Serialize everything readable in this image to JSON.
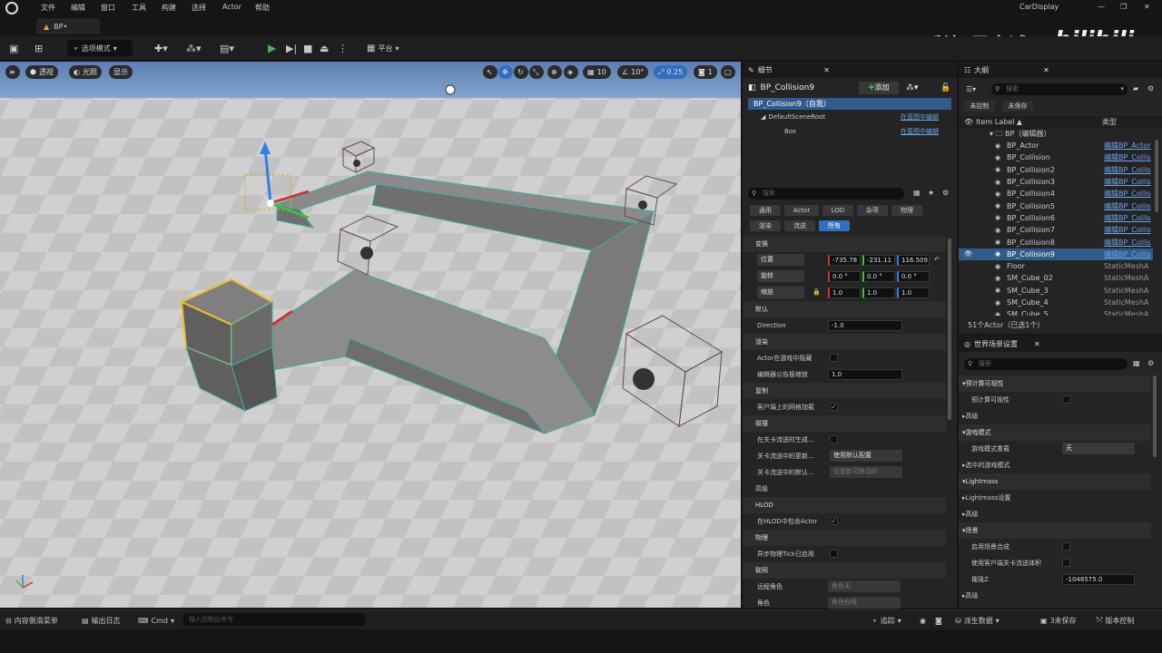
{
  "menu": {
    "items": [
      "文件",
      "编辑",
      "窗口",
      "工具",
      "构建",
      "选择",
      "Actor",
      "帮助"
    ],
    "window_title": "CarDisplay"
  },
  "tab": {
    "name": "BP•"
  },
  "watermark": {
    "author": "乔治-周士诚",
    "site": "bilibili"
  },
  "toolbar": {
    "mode": "选项模式",
    "platform": "平台"
  },
  "viewport": {
    "perspective": "透视",
    "lit": "光照",
    "show": "显示",
    "grid_snap": "10",
    "rot_snap": "10°",
    "scale_snap": "0.25",
    "cam_speed": "1"
  },
  "details": {
    "title": "细节",
    "actor": "BP_Collision9",
    "add": "添加",
    "tree": {
      "self": "BP_Collision9（自我）",
      "root": "DefaultSceneRoot",
      "box": "Box",
      "edit_bp": "在蓝图中编辑"
    },
    "search_placeholder": "搜索",
    "filters": [
      "通用",
      "Actor",
      "LOD",
      "杂项",
      "物理",
      "渲染",
      "流送",
      "所有"
    ],
    "transform": {
      "section": "变换",
      "location": "位置",
      "rotation": "旋转",
      "scale": "缩放",
      "loc": [
        "-735.78",
        "-231.11",
        "116.509"
      ],
      "rot": [
        "0.0 °",
        "0.0 °",
        "0.0 °"
      ],
      "scl": [
        "1.0",
        "1.0",
        "1.0"
      ]
    },
    "default": {
      "section": "默认",
      "direction_label": "Direction",
      "direction": "-1.0"
    },
    "rendering": {
      "section": "渲染",
      "hidden_label": "Actor在游戏中隐藏",
      "billboard_label": "编辑器公告板缩放",
      "billboard": "1.0"
    },
    "replication": {
      "section": "复制",
      "net_load_label": "客户端上的网格加载"
    },
    "collision": {
      "section": "碰撞",
      "gen_label": "在关卡流送时生成...",
      "update_label": "关卡流送中的更新...",
      "update_value": "使用默认配置",
      "default_label": "关卡流送中的默认...",
      "default_value": "仅更新可移动的"
    },
    "advanced": "高级",
    "hlod": {
      "section": "HLOD",
      "include_label": "在HLOD中包含Actor"
    },
    "physics": {
      "section": "物理",
      "async_label": "异步物理Tick已启用"
    },
    "networking": {
      "section": "联网",
      "remote_label": "远程角色",
      "remote_value": "角色无",
      "role_label": "角色",
      "role_value": "角色权限"
    }
  },
  "outliner": {
    "title": "大纲",
    "search_placeholder": "搜索",
    "unsaved_ctrl": "未控制",
    "unsaved": "未保存",
    "col_label": "Item Label ▲",
    "col_type": "类型",
    "folder": "BP（编辑器）",
    "items": [
      {
        "name": "BP_Actor",
        "type": "编辑BP_Actor"
      },
      {
        "name": "BP_Collision",
        "type": "编辑BP_Collis"
      },
      {
        "name": "BP_Collision2",
        "type": "编辑BP_Collis"
      },
      {
        "name": "BP_Collision3",
        "type": "编辑BP_Collis"
      },
      {
        "name": "BP_Collision4",
        "type": "编辑BP_Collis"
      },
      {
        "name": "BP_Collision5",
        "type": "编辑BP_Collis"
      },
      {
        "name": "BP_Collision6",
        "type": "编辑BP_Collis"
      },
      {
        "name": "BP_Collision7",
        "type": "编辑BP_Collis"
      },
      {
        "name": "BP_Collision8",
        "type": "编辑BP_Collis"
      },
      {
        "name": "BP_Collision9",
        "type": "编辑BP_Collis"
      },
      {
        "name": "Floor",
        "type": "StaticMeshA"
      },
      {
        "name": "SM_Cube_02",
        "type": "StaticMeshA"
      },
      {
        "name": "SM_Cube_3",
        "type": "StaticMeshA"
      },
      {
        "name": "SM_Cube_4",
        "type": "StaticMeshA"
      },
      {
        "name": "SM_Cube_5",
        "type": "StaticMeshA"
      }
    ],
    "count": "51个Actor（已选1个）"
  },
  "world": {
    "title": "世界场景设置",
    "search_placeholder": "搜索",
    "rows": [
      {
        "kind": "sec",
        "label": "预计算可视性"
      },
      {
        "kind": "chk",
        "label": "预计算可视性"
      },
      {
        "kind": "sub",
        "label": "高级"
      },
      {
        "kind": "sec",
        "label": "游戏模式"
      },
      {
        "kind": "dd",
        "label": "游戏模式重载",
        "value": "无"
      },
      {
        "kind": "sub",
        "label": "选中的游戏模式"
      },
      {
        "kind": "sec",
        "label": "Lightmass"
      },
      {
        "kind": "sub",
        "label": "Lightmass设置"
      },
      {
        "kind": "sub",
        "label": "高级"
      },
      {
        "kind": "sec",
        "label": "场景"
      },
      {
        "kind": "chk",
        "label": "启用场景合成"
      },
      {
        "kind": "chk",
        "label": "使用客户端关卡流送体积"
      },
      {
        "kind": "field",
        "label": "摧毁Z",
        "value": "-1048575.0"
      },
      {
        "kind": "sub",
        "label": "高级"
      }
    ]
  },
  "status": {
    "drawer": "内容侧滑菜单",
    "output": "输出日志",
    "cmd": "Cmd",
    "console_placeholder": "输入控制台命令",
    "trace": "追踪",
    "derived": "派生数据",
    "unsaved": "3未保存",
    "source": "版本控制"
  }
}
